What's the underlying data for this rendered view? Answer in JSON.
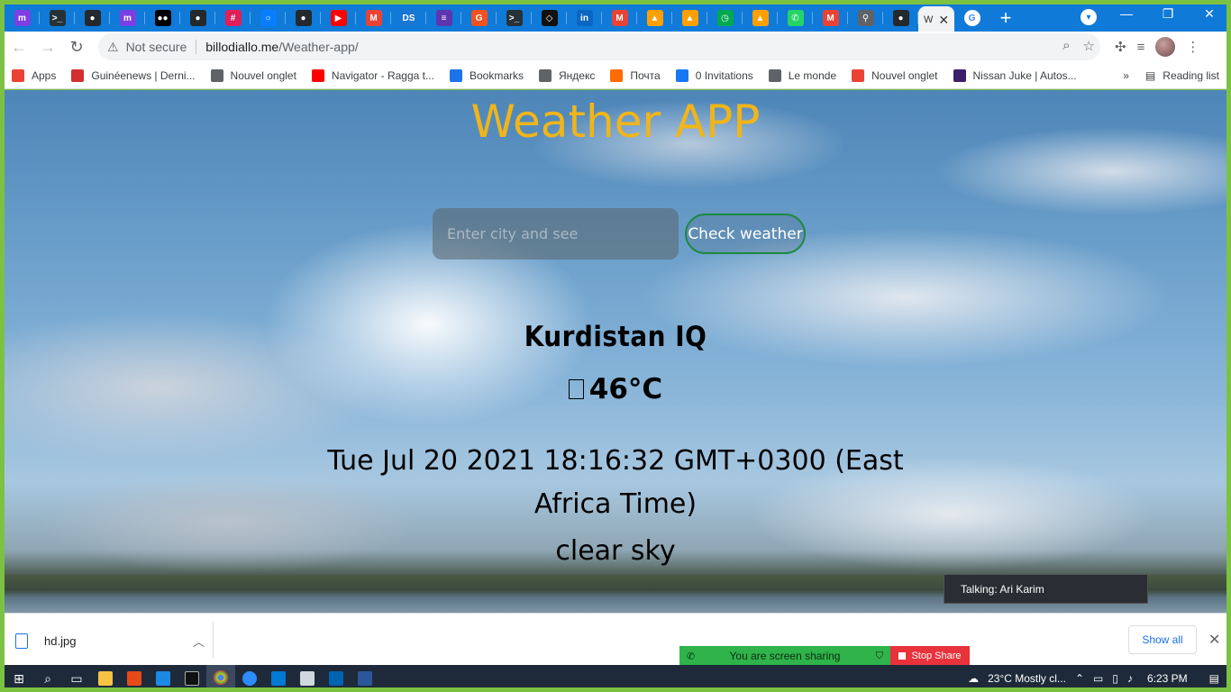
{
  "browser": {
    "tabs": [
      {
        "icon": "multi-m-icon",
        "color": "#7b3fe4",
        "glyph": "m"
      },
      {
        "icon": "terminal-icon",
        "color": "#263238",
        "glyph": ">_"
      },
      {
        "icon": "github-icon",
        "color": "#24292e",
        "glyph": "●"
      },
      {
        "icon": "multi-m-icon",
        "color": "#7b3fe4",
        "glyph": "m"
      },
      {
        "icon": "medium-icon",
        "color": "#000000",
        "glyph": "●●"
      },
      {
        "icon": "github-icon",
        "color": "#24292e",
        "glyph": "●"
      },
      {
        "icon": "slack-icon",
        "color": "#e01e5a",
        "glyph": "#"
      },
      {
        "icon": "messenger-icon",
        "color": "#0a7cff",
        "glyph": "○"
      },
      {
        "icon": "github-icon",
        "color": "#24292e",
        "glyph": "●"
      },
      {
        "icon": "youtube-icon",
        "color": "#ff0000",
        "glyph": "▶"
      },
      {
        "icon": "gmail-icon",
        "color": "#ea4335",
        "glyph": "M"
      },
      {
        "icon": "ds-icon",
        "color": "#1976d2",
        "glyph": "DS"
      },
      {
        "icon": "list-icon",
        "color": "#5e35b1",
        "glyph": "≡"
      },
      {
        "icon": "grammarly-icon",
        "color": "#f4511e",
        "glyph": "G"
      },
      {
        "icon": "terminal-icon",
        "color": "#263238",
        "glyph": ">_"
      },
      {
        "icon": "codepen-icon",
        "color": "#111111",
        "glyph": "◇"
      },
      {
        "icon": "linkedin-icon",
        "color": "#0a66c2",
        "glyph": "in"
      },
      {
        "icon": "gmail-icon",
        "color": "#ea4335",
        "glyph": "M"
      },
      {
        "icon": "firebase-icon",
        "color": "#ffa000",
        "glyph": "▲"
      },
      {
        "icon": "firebase-icon",
        "color": "#ffa000",
        "glyph": "▲"
      },
      {
        "icon": "clock-icon",
        "color": "#00a84f",
        "glyph": "◷"
      },
      {
        "icon": "firebase-icon",
        "color": "#ffa000",
        "glyph": "▲"
      },
      {
        "icon": "whatsapp-icon",
        "color": "#25d366",
        "glyph": "✆"
      },
      {
        "icon": "gmail-icon",
        "color": "#ea4335",
        "glyph": "M"
      },
      {
        "icon": "pin-icon",
        "color": "#5f6368",
        "glyph": "⚲"
      },
      {
        "icon": "github-icon",
        "color": "#24292e",
        "glyph": "●"
      }
    ],
    "active_tab_label": "W",
    "address": {
      "security_label": "Not secure",
      "host": "billodiallo.me",
      "path": "/Weather-app/"
    },
    "bookmarks": [
      {
        "label": "Apps",
        "icon": "apps-grid-icon",
        "color": "#e94235"
      },
      {
        "label": "Guinéenews | Derni...",
        "icon": "guineenews-icon",
        "color": "#d32f2f"
      },
      {
        "label": "Nouvel onglet",
        "icon": "globe-icon",
        "color": "#5f6368"
      },
      {
        "label": "Navigator - Ragga t...",
        "icon": "youtube-icon",
        "color": "#ff0000"
      },
      {
        "label": "Bookmarks",
        "icon": "star-icon",
        "color": "#1a73e8"
      },
      {
        "label": "Яндекс",
        "icon": "globe-icon",
        "color": "#5f6368"
      },
      {
        "label": "Почта",
        "icon": "mail-icon",
        "color": "#ff6b00"
      },
      {
        "label": "0 Invitations",
        "icon": "facebook-icon",
        "color": "#1877f2"
      },
      {
        "label": "Le monde",
        "icon": "globe-icon",
        "color": "#5f6368"
      },
      {
        "label": "Nouvel onglet",
        "icon": "gmail-icon",
        "color": "#ea4335"
      },
      {
        "label": "Nissan Juke | Autos...",
        "icon": "k-icon",
        "color": "#3b1f6b"
      }
    ],
    "reading_list_label": "Reading list"
  },
  "app": {
    "title": "Weather APP",
    "search_placeholder": "Enter city and see",
    "check_button": "Check weather",
    "city": "Kurdistan  IQ",
    "temperature": "46°C",
    "datetime": "Tue Jul 20 2021 18:16:32 GMT+0300 (East Africa Time)",
    "description": "clear sky",
    "title_color": "#f0b51a"
  },
  "meeting": {
    "talking": "Talking: Ari Karim",
    "sharing_label": "You are screen sharing",
    "stop_share_label": "Stop Share"
  },
  "downloads": {
    "file_name": "hd.jpg",
    "show_all": "Show all"
  },
  "taskbar": {
    "weather": "23°C  Mostly cl...",
    "time": "6:23 PM"
  }
}
